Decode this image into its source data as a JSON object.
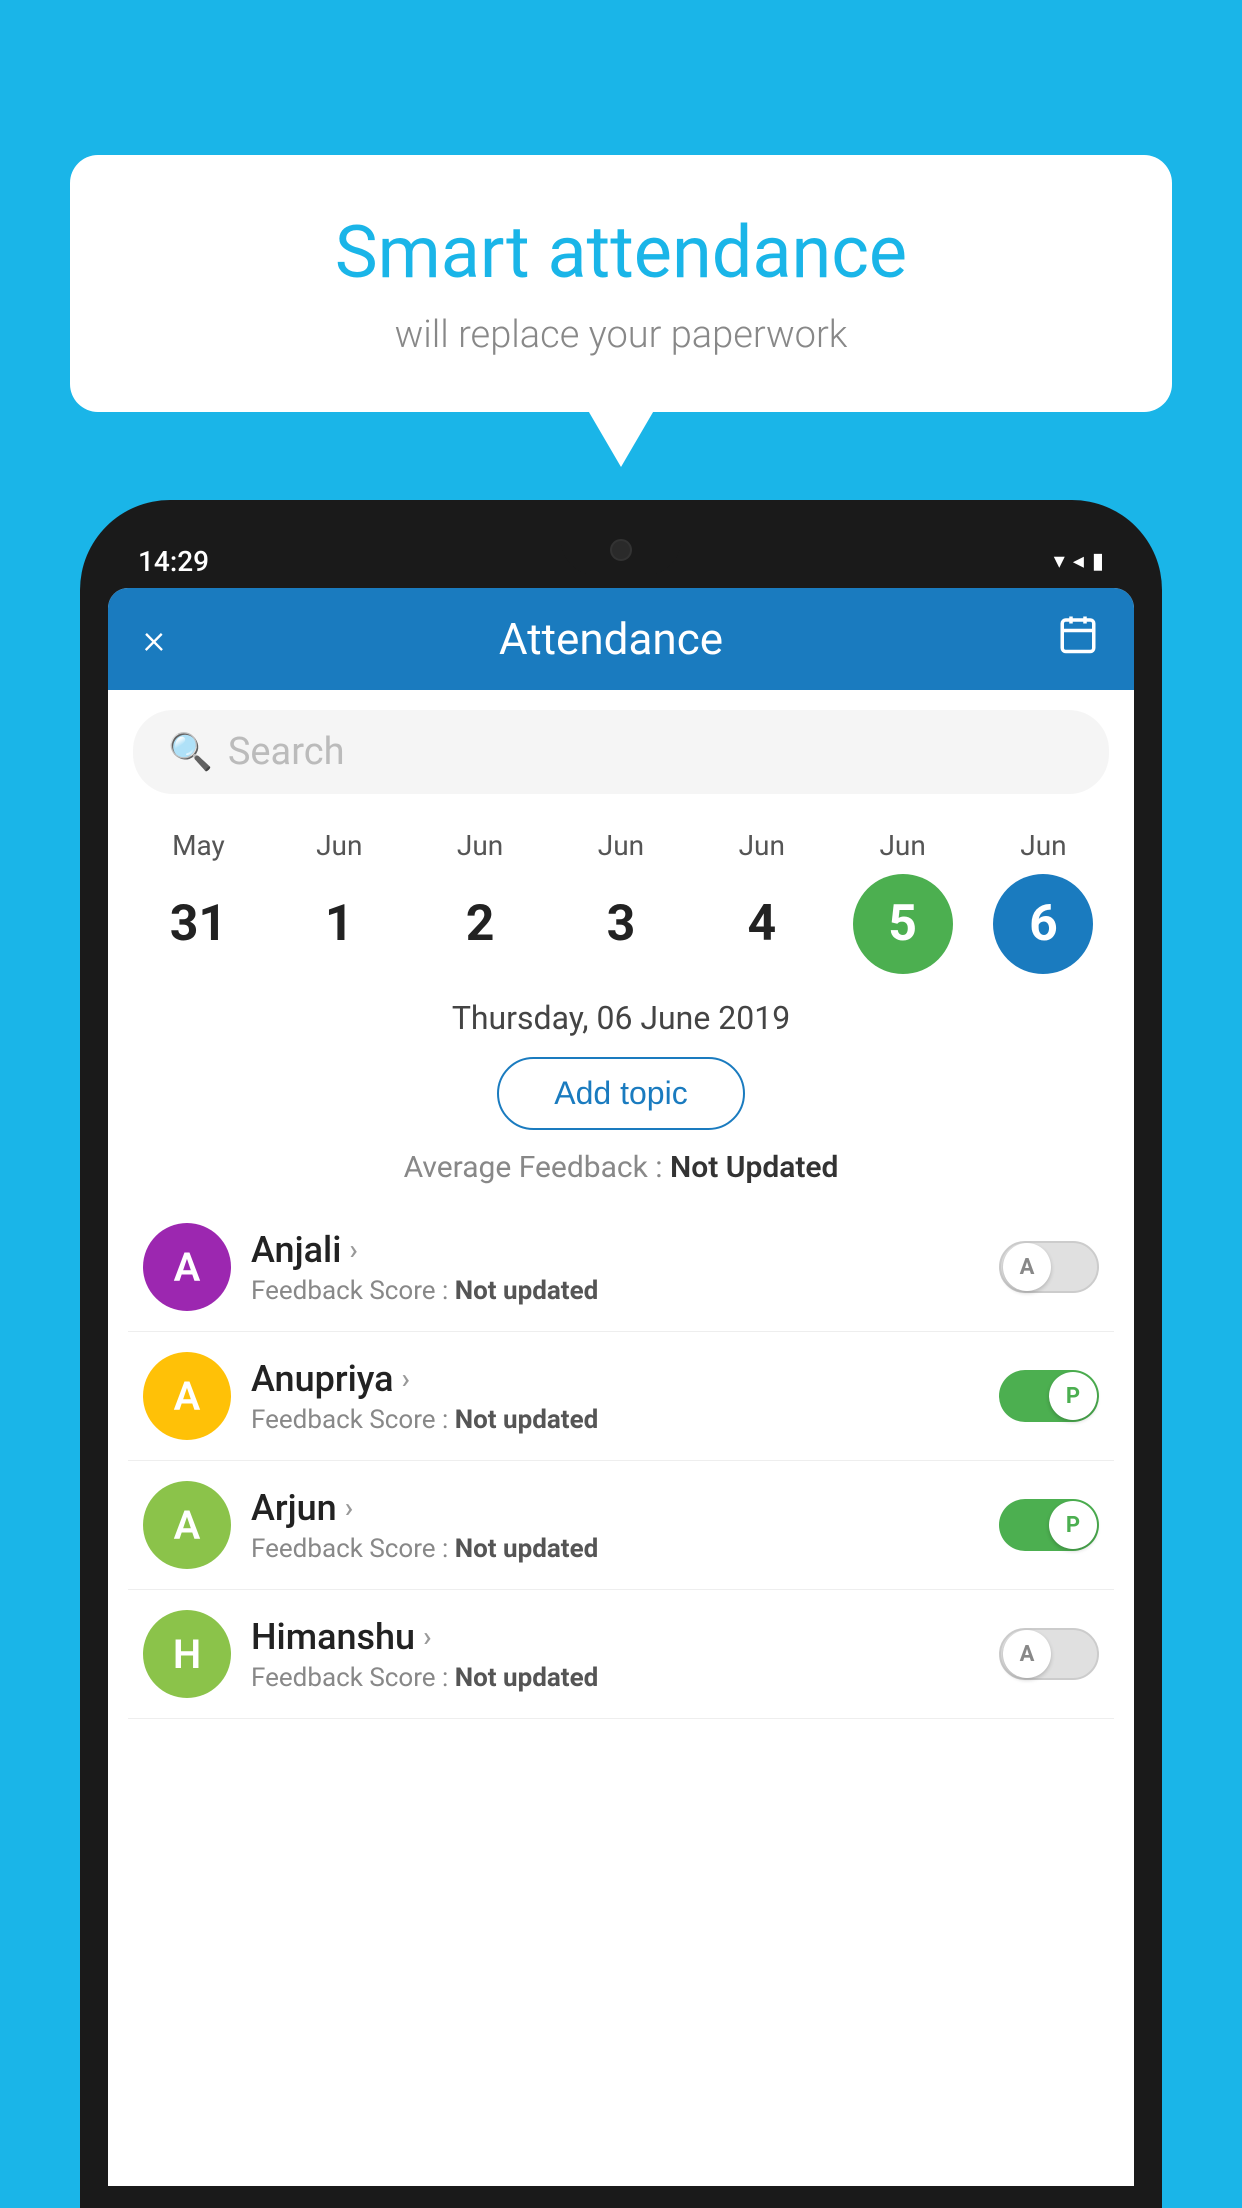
{
  "background": {
    "color": "#1ab5e8"
  },
  "bubble": {
    "title": "Smart attendance",
    "subtitle": "will replace your paperwork"
  },
  "status_bar": {
    "time": "14:29"
  },
  "header": {
    "title": "Attendance",
    "close_label": "×",
    "calendar_icon": "calendar-icon"
  },
  "search": {
    "placeholder": "Search"
  },
  "calendar": {
    "days": [
      {
        "month": "May",
        "date": "31",
        "state": "normal"
      },
      {
        "month": "Jun",
        "date": "1",
        "state": "normal"
      },
      {
        "month": "Jun",
        "date": "2",
        "state": "normal"
      },
      {
        "month": "Jun",
        "date": "3",
        "state": "normal"
      },
      {
        "month": "Jun",
        "date": "4",
        "state": "normal"
      },
      {
        "month": "Jun",
        "date": "5",
        "state": "today"
      },
      {
        "month": "Jun",
        "date": "6",
        "state": "selected"
      }
    ]
  },
  "selected_date": "Thursday, 06 June 2019",
  "add_topic_label": "Add topic",
  "avg_feedback_label": "Average Feedback :",
  "avg_feedback_value": "Not Updated",
  "students": [
    {
      "name": "Anjali",
      "avatar_letter": "A",
      "avatar_color": "#9c27b0",
      "feedback_label": "Feedback Score :",
      "feedback_value": "Not updated",
      "toggle": "off",
      "toggle_letter": "A"
    },
    {
      "name": "Anupriya",
      "avatar_letter": "A",
      "avatar_color": "#ffc107",
      "feedback_label": "Feedback Score :",
      "feedback_value": "Not updated",
      "toggle": "on",
      "toggle_letter": "P"
    },
    {
      "name": "Arjun",
      "avatar_letter": "A",
      "avatar_color": "#8bc34a",
      "feedback_label": "Feedback Score :",
      "feedback_value": "Not updated",
      "toggle": "on",
      "toggle_letter": "P"
    },
    {
      "name": "Himanshu",
      "avatar_letter": "H",
      "avatar_color": "#8bc34a",
      "feedback_label": "Feedback Score :",
      "feedback_value": "Not updated",
      "toggle": "off",
      "toggle_letter": "A"
    }
  ]
}
